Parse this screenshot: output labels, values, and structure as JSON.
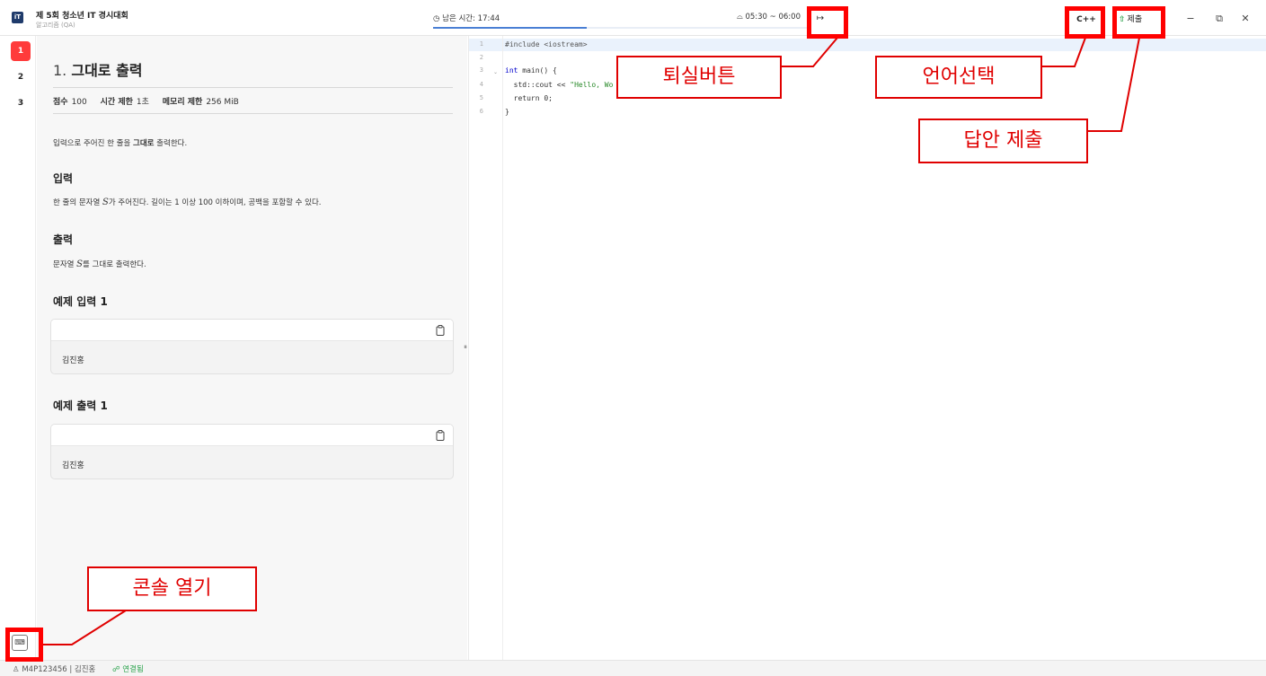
{
  "header": {
    "logo_text": "iT",
    "contest_title": "제 5회 청소년 IT 경시대회",
    "contest_subtitle": "알고리즘 (QA)",
    "timer_label": "◷ 남은 시간: 17:44",
    "time_range": "⌓ 05:30 ~ 06:00",
    "time_progress_fraction": 0.41,
    "exit_icon": "↦",
    "language": "C++",
    "submit_icon": "⇧",
    "submit_label": "제출",
    "window_controls": {
      "minimize": "−",
      "restore": "⧉",
      "close": "✕"
    }
  },
  "rail": {
    "problems": [
      "1",
      "2",
      "3"
    ],
    "active_index": 0,
    "console_icon": "⌨"
  },
  "problem": {
    "number": "1.",
    "title": "그대로 출력",
    "score_label": "점수",
    "score_value": "100",
    "time_label": "시간 제한",
    "time_value": "1초",
    "memory_label": "메모리 제한",
    "memory_value": "256 MiB",
    "description_prefix": "입력으로 주어진 한 줄을 ",
    "description_bold": "그대로",
    "description_suffix": " 출력한다.",
    "input_heading": "입력",
    "input_prefix": "한 줄의 문자열 ",
    "input_var": "S",
    "input_suffix": "가 주어진다. 길이는 1 이상 100 이하이며, 공백을 포함할 수 있다.",
    "output_heading": "출력",
    "output_prefix": "문자열 ",
    "output_var": "S",
    "output_suffix": "를 그대로 출력한다.",
    "sample_input_heading": "예제 입력 1",
    "sample_input_value": "김진홍",
    "sample_output_heading": "예제 출력 1",
    "sample_output_value": "김진홍"
  },
  "editor": {
    "line_numbers": [
      "1",
      "2",
      "3",
      "4",
      "5",
      "6"
    ],
    "lines": [
      {
        "pp": "#include <iostream>"
      },
      {
        "text": ""
      },
      {
        "kw": "int",
        "text": " main() {"
      },
      {
        "text": "  std::cout << ",
        "str": "\"Hello, Wo"
      },
      {
        "text": "  return 0;"
      },
      {
        "text": "}"
      }
    ]
  },
  "status": {
    "user": "♙ M4P123456 | 김진홍",
    "connection": "☍ 연결됨"
  },
  "annotations": {
    "exit": "퇴실버튼",
    "language": "언어선택",
    "submit": "답안 제출",
    "console": "콘솔 열기"
  },
  "colors": {
    "active_problem": "#ff3b3b",
    "annotation": "#ff0000",
    "connected": "#2da44e",
    "timer_progress": "#4a7fd4"
  }
}
